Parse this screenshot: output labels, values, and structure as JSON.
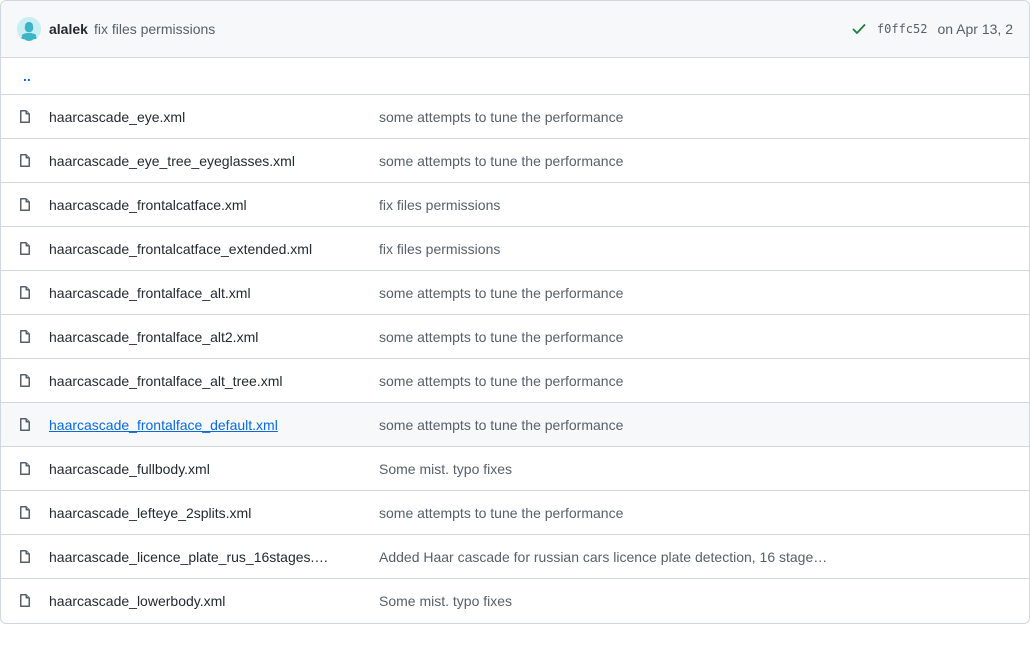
{
  "header": {
    "author": "alalek",
    "title": "fix files permissions",
    "sha": "f0ffc52",
    "date": "on Apr 13, 2"
  },
  "updir": "..",
  "files": [
    {
      "name": "haarcascade_eye.xml",
      "msg": "some attempts to tune the performance",
      "hover": false
    },
    {
      "name": "haarcascade_eye_tree_eyeglasses.xml",
      "msg": "some attempts to tune the performance",
      "hover": false
    },
    {
      "name": "haarcascade_frontalcatface.xml",
      "msg": "fix files permissions",
      "hover": false
    },
    {
      "name": "haarcascade_frontalcatface_extended.xml",
      "msg": "fix files permissions",
      "hover": false
    },
    {
      "name": "haarcascade_frontalface_alt.xml",
      "msg": "some attempts to tune the performance",
      "hover": false
    },
    {
      "name": "haarcascade_frontalface_alt2.xml",
      "msg": "some attempts to tune the performance",
      "hover": false
    },
    {
      "name": "haarcascade_frontalface_alt_tree.xml",
      "msg": "some attempts to tune the performance",
      "hover": false
    },
    {
      "name": "haarcascade_frontalface_default.xml",
      "msg": "some attempts to tune the performance",
      "hover": true
    },
    {
      "name": "haarcascade_fullbody.xml",
      "msg": "Some mist. typo fixes",
      "hover": false
    },
    {
      "name": "haarcascade_lefteye_2splits.xml",
      "msg": "some attempts to tune the performance",
      "hover": false
    },
    {
      "name": "haarcascade_licence_plate_rus_16stages.…",
      "msg": "Added Haar cascade for russian cars licence plate detection, 16 stage…",
      "hover": false
    },
    {
      "name": "haarcascade_lowerbody.xml",
      "msg": "Some mist. typo fixes",
      "hover": false
    }
  ]
}
